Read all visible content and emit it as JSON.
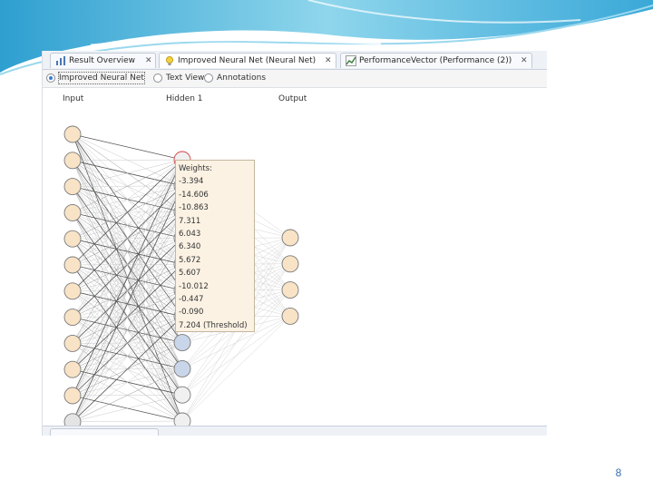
{
  "tabs": [
    {
      "label": "Result Overview",
      "icon": "chart-icon",
      "active": false
    },
    {
      "label": "Improved Neural Net (Neural Net)",
      "icon": "lightbulb-icon",
      "active": true
    },
    {
      "label": "PerformanceVector (Performance (2))",
      "icon": "performance-icon",
      "active": false
    }
  ],
  "views": [
    {
      "label": "Improved Neural Net",
      "selected": true
    },
    {
      "label": "Text View",
      "selected": false
    },
    {
      "label": "Annotations",
      "selected": false
    }
  ],
  "layers": {
    "input": "Input",
    "hidden": "Hidden 1",
    "output": "Output"
  },
  "network": {
    "input_count": 12,
    "hidden_count": 11,
    "output_count": 4,
    "hovered_hidden_node": 1
  },
  "tooltip": {
    "title": "Weights:",
    "lines": [
      "-3.394",
      "-14.606",
      "-10.863",
      "7.311",
      "6.043",
      "6.340",
      "5.672",
      "5.607",
      "-10.012",
      "-0.447",
      "-0.090",
      "7.204 (Threshold)"
    ]
  },
  "colors": {
    "input_node": "#f9e3c6",
    "hidden_node": "#f0f0f0",
    "hidden_highlight": "#c9d6ea",
    "hover_ring": "#d04040",
    "accent": "#3a7bd5"
  },
  "slide_number": "8"
}
